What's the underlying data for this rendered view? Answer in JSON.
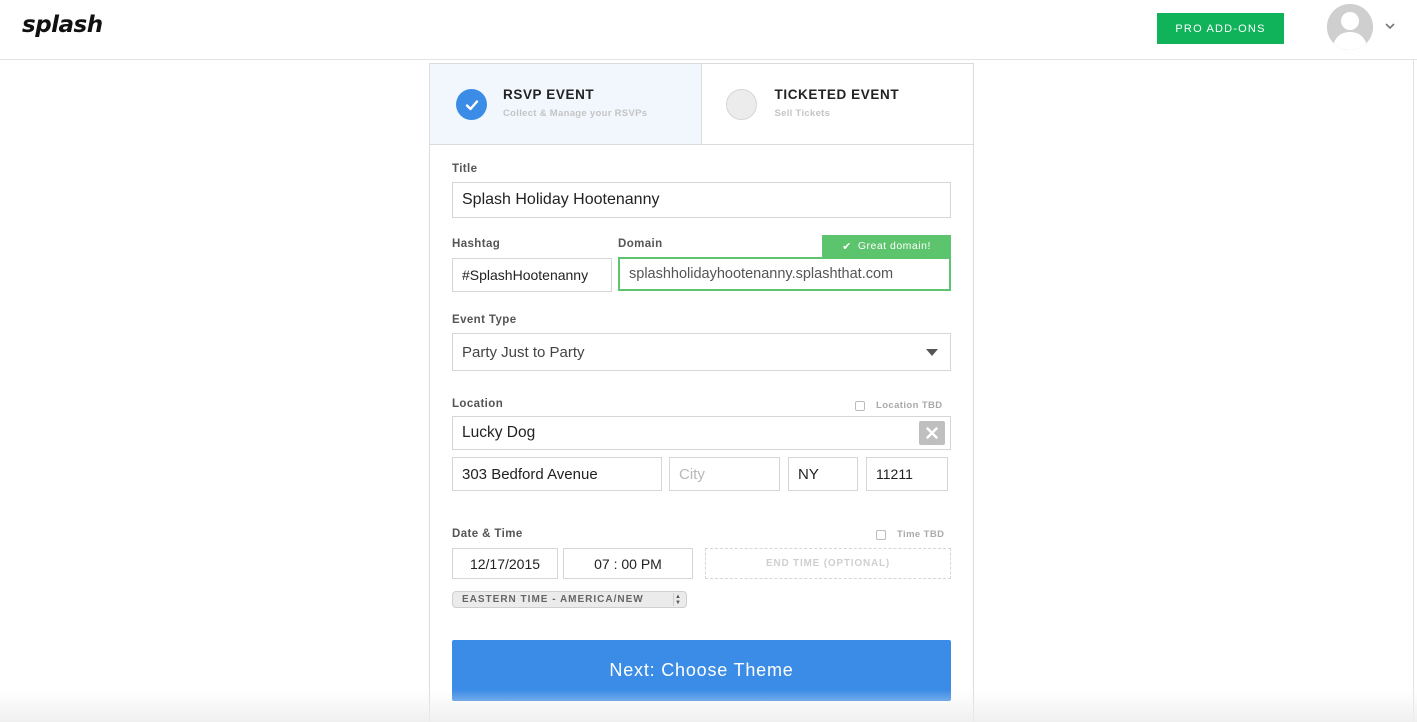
{
  "header": {
    "logo": "splash",
    "pro_addons_label": "PRO ADD-ONS"
  },
  "event_types": {
    "rsvp": {
      "title": "RSVP EVENT",
      "subtitle": "Collect & Manage your RSVPs",
      "selected": true
    },
    "ticketed": {
      "title": "TICKETED EVENT",
      "subtitle": "Sell Tickets",
      "selected": false
    }
  },
  "form": {
    "title_label": "Title",
    "title_value": "Splash Holiday Hootenanny",
    "hashtag_label": "Hashtag",
    "hashtag_value": "#SplashHootenanny",
    "domain_label": "Domain",
    "domain_value": "splashholidayhootenanny.splashthat.com",
    "domain_status": "Great domain!",
    "event_type_label": "Event Type",
    "event_type_value": "Party Just to Party",
    "location_label": "Location",
    "location_tbd_label": "Location TBD",
    "location_name": "Lucky Dog",
    "address": "303 Bedford Avenue",
    "city_placeholder": "City",
    "state": "NY",
    "zip": "11211",
    "datetime_label": "Date & Time",
    "time_tbd_label": "Time TBD",
    "date": "12/17/2015",
    "time": "07 : 00 PM",
    "end_time_placeholder": "END TIME (OPTIONAL)",
    "timezone": "EASTERN TIME - AMERICA/NEW"
  },
  "next_button_label": "Next: Choose Theme",
  "colors": {
    "primary_blue": "#3b8ce6",
    "success_green": "#5cc46c",
    "pro_green": "#10b35a"
  }
}
